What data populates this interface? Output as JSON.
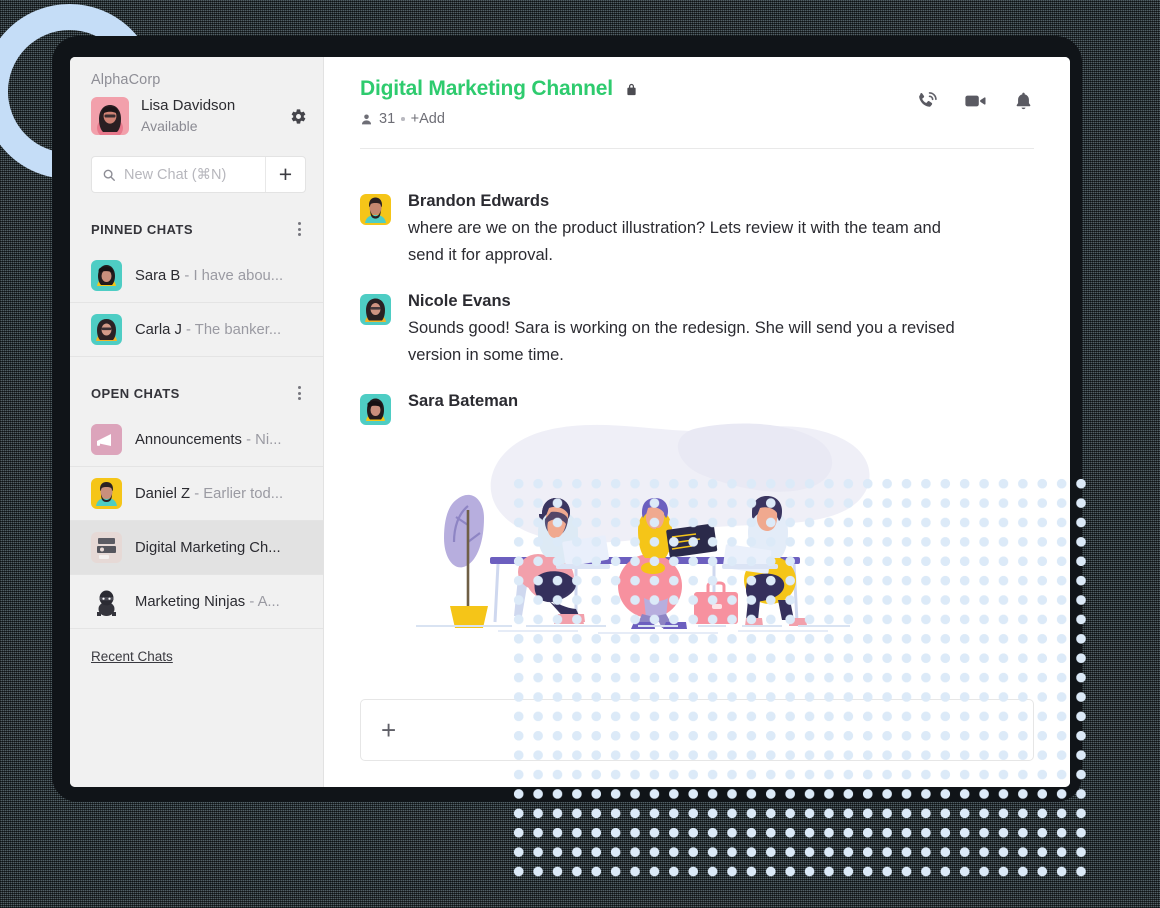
{
  "theme": {
    "page_background": "#3f4f56",
    "accent_green": "#2ecb6e",
    "ring_blue": "#c5ddf7",
    "dot_blue": "#dceaf8",
    "sidebar_background": "#f1f1f1",
    "selected_row": "#e2e2e2"
  },
  "sidebar": {
    "org_name": "AlphaCorp",
    "profile": {
      "name": "Lisa Davidson",
      "status": "Available",
      "avatar": "lisa-davidson-avatar",
      "settings_icon": "gear-icon"
    },
    "search": {
      "placeholder": "New Chat (⌘N)",
      "icon": "search-icon",
      "add_label": "+"
    },
    "sections": [
      {
        "title": "PINNED CHATS",
        "menu_icon": "kebab-menu-icon",
        "items": [
          {
            "name": "Sara B",
            "separator": "-",
            "preview": "I have abou...",
            "avatar": "sara-b-avatar",
            "selected": false
          },
          {
            "name": "Carla J",
            "separator": "-",
            "preview": "The banker...",
            "avatar": "carla-j-avatar",
            "selected": false
          }
        ]
      },
      {
        "title": "OPEN CHATS",
        "menu_icon": "kebab-menu-icon",
        "items": [
          {
            "name": "Announcements",
            "separator": "-",
            "preview": "Ni...",
            "avatar": "announcements-avatar",
            "selected": false
          },
          {
            "name": "Daniel Z",
            "separator": "-",
            "preview": "Earlier tod...",
            "avatar": "daniel-z-avatar",
            "selected": false
          },
          {
            "name": "Digital Marketing Ch...",
            "separator": "",
            "preview": "",
            "avatar": "digital-marketing-avatar",
            "selected": true
          },
          {
            "name": "Marketing Ninjas",
            "separator": "-",
            "preview": "A...",
            "avatar": "marketing-ninjas-avatar",
            "selected": false
          }
        ]
      }
    ],
    "recent_chats_link": "Recent Chats"
  },
  "main": {
    "channel_title": "Digital Marketing Channel",
    "lock_icon": "lock-icon",
    "members_icon": "person-icon",
    "member_count": "31",
    "add_label": "+Add",
    "actions": [
      {
        "name": "call-icon",
        "label": "Call"
      },
      {
        "name": "video-icon",
        "label": "Video"
      },
      {
        "name": "bell-icon",
        "label": "Notifications"
      }
    ],
    "messages": [
      {
        "author": "Brandon Edwards",
        "avatar": "brandon-edwards-avatar",
        "text": "where are we on the product illustration? Lets review it with the team and send it for approval."
      },
      {
        "author": "Nicole Evans",
        "avatar": "nicole-evans-avatar",
        "text": "Sounds good! Sara is working on the redesign. She will send you a revised version in some time."
      },
      {
        "author": "Sara Bateman",
        "avatar": "sara-bateman-avatar",
        "text": "",
        "attachment": "team-working-illustration"
      }
    ],
    "composer": {
      "attach_label": "+",
      "value": "",
      "placeholder": ""
    }
  }
}
